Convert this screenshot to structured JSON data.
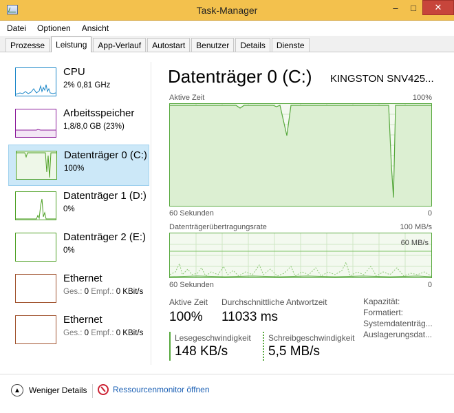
{
  "window": {
    "title": "Task-Manager",
    "min": "–",
    "max": "□",
    "close": "✕"
  },
  "menu": [
    "Datei",
    "Optionen",
    "Ansicht"
  ],
  "tabs": [
    "Prozesse",
    "Leistung",
    "App-Verlauf",
    "Autostart",
    "Benutzer",
    "Details",
    "Dienste"
  ],
  "active_tab": "Leistung",
  "sidebar": [
    {
      "title": "CPU",
      "sub": "2%  0,81 GHz",
      "color": "#1a86c8"
    },
    {
      "title": "Arbeitsspeicher",
      "sub": "1,8/8,0 GB (23%)",
      "color": "#8b1a9a"
    },
    {
      "title": "Datenträger 0 (C:)",
      "sub": "100%",
      "color": "#4da024"
    },
    {
      "title": "Datenträger 1 (D:)",
      "sub": "0%",
      "color": "#4da024"
    },
    {
      "title": "Datenträger 2 (E:)",
      "sub": "0%",
      "color": "#4da024"
    },
    {
      "title": "Ethernet",
      "sub_muted1": "Ges.:",
      "sub_val1": " 0 ",
      "sub_muted2": "Empf.:",
      "sub_val2": " 0 KBit/s",
      "color": "#a0522d"
    },
    {
      "title": "Ethernet",
      "sub_muted1": "Ges.:",
      "sub_val1": " 0 ",
      "sub_muted2": "Empf.:",
      "sub_val2": " 0 KBit/s",
      "color": "#a0522d"
    }
  ],
  "main": {
    "title": "Datenträger 0 (C:)",
    "model": "KINGSTON SNV425...",
    "graph1": {
      "label_left": "Aktive Zeit",
      "label_right": "100%",
      "bottom_left": "60 Sekunden",
      "bottom_right": "0"
    },
    "graph2": {
      "label_left": "Datenträgerübertragungsrate",
      "label_right": "100 MB/s",
      "inner_label": "60 MB/s",
      "bottom_left": "60 Sekunden",
      "bottom_right": "0"
    },
    "stats": {
      "active_label": "Aktive Zeit",
      "active_value": "100%",
      "resp_label": "Durchschnittliche Antwortzeit",
      "resp_value": "11033 ms",
      "read_label": "Lesegeschwindigkeit",
      "read_value": "148 KB/s",
      "write_label": "Schreibgeschwindigkeit",
      "write_value": "5,5 MB/s"
    },
    "props": [
      "Kapazität:",
      "Formatiert:",
      "Systemdatenträg...",
      "Auslagerungsdat..."
    ]
  },
  "bottom": {
    "fewer": "Weniger Details",
    "resmon": "Ressourcenmonitor öffnen"
  },
  "colors": {
    "disk_green": "#56a83c",
    "title_orange": "#f3c14d",
    "selected_bg": "#cce8f8"
  }
}
